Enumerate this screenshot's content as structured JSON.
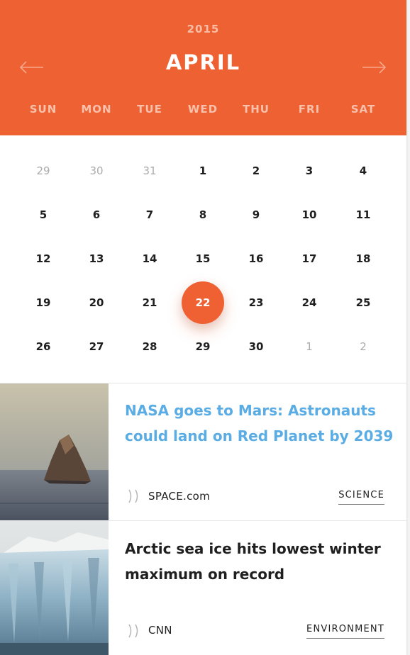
{
  "calendar": {
    "year": "2015",
    "month": "APRIL",
    "weekdays": [
      "SUN",
      "MON",
      "TUE",
      "WED",
      "THU",
      "FRI",
      "SAT"
    ],
    "selected_day": "22",
    "weeks": [
      [
        {
          "d": "29",
          "muted": true
        },
        {
          "d": "30",
          "muted": true
        },
        {
          "d": "31",
          "muted": true
        },
        {
          "d": "1"
        },
        {
          "d": "2"
        },
        {
          "d": "3"
        },
        {
          "d": "4"
        }
      ],
      [
        {
          "d": "5"
        },
        {
          "d": "6"
        },
        {
          "d": "7"
        },
        {
          "d": "8"
        },
        {
          "d": "9"
        },
        {
          "d": "10"
        },
        {
          "d": "11"
        }
      ],
      [
        {
          "d": "12"
        },
        {
          "d": "13"
        },
        {
          "d": "14"
        },
        {
          "d": "15"
        },
        {
          "d": "16"
        },
        {
          "d": "17"
        },
        {
          "d": "18"
        }
      ],
      [
        {
          "d": "19"
        },
        {
          "d": "20"
        },
        {
          "d": "21"
        },
        {
          "d": "22"
        },
        {
          "d": "23"
        },
        {
          "d": "24"
        },
        {
          "d": "25"
        }
      ],
      [
        {
          "d": "26"
        },
        {
          "d": "27"
        },
        {
          "d": "28"
        },
        {
          "d": "29"
        },
        {
          "d": "30"
        },
        {
          "d": "1",
          "muted": true
        },
        {
          "d": "2",
          "muted": true
        }
      ]
    ]
  },
  "news": [
    {
      "headline_line1": "NASA goes to Mars: Astronauts",
      "headline_line2": "could land on Red Planet by 2039",
      "source": "SPACE.com",
      "category": "SCIENCE",
      "headline_color": "#5aace4",
      "thumbnail_icon": "sea-rock-photo"
    },
    {
      "headline_line1": "Arctic sea ice hits lowest winter",
      "headline_line2": "maximum on record",
      "source": "CNN",
      "category": "ENVIRONMENT",
      "headline_color": "#1f1f1f",
      "thumbnail_icon": "glacier-photo"
    }
  ],
  "colors": {
    "accent": "#ee6133",
    "weekday_text": "#f9c1ab",
    "muted_day": "#ababab"
  }
}
